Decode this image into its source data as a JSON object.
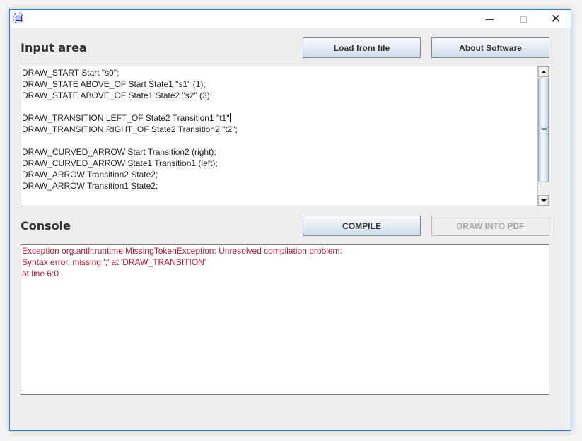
{
  "window": {
    "title": "",
    "icon": "java-app-icon",
    "controls": {
      "minimize": "minimize-icon",
      "maximize": "maximize-icon",
      "close": "close-icon",
      "close_glyph": "✕"
    }
  },
  "input_section": {
    "heading": "Input area",
    "buttons": {
      "load_label": "Load from file",
      "about_label": "About Software"
    },
    "lines": [
      "DRAW_START Start \"s0\";",
      "DRAW_STATE ABOVE_OF Start State1 \"s1\" (1);",
      "DRAW_STATE ABOVE_OF State1 State2 \"s2\" (3);",
      "",
      "DRAW_TRANSITION LEFT_OF State2 Transition1 \"t1\"",
      "DRAW_TRANSITION RIGHT_OF State2 Transition2 \"t2\";",
      "",
      "DRAW_CURVED_ARROW Start Transition2 (right);",
      "DRAW_CURVED_ARROW State1 Transition1 (left);",
      "DRAW_ARROW Transition2 State2;",
      "DRAW_ARROW Transition1 State2;"
    ]
  },
  "console_section": {
    "heading": "Console",
    "buttons": {
      "compile_label": "COMPILE",
      "pdf_label": "DRAW INTO PDF",
      "pdf_enabled": false
    },
    "lines": [
      "Exception org.antlr.runtime.MissingTokenException: Unresolved compilation problem:",
      "Syntax error, missing ';' at 'DRAW_TRANSITION'",
      "at line 6:0"
    ],
    "error_color": "#c0142e"
  },
  "colors": {
    "window_border": "#1883d7",
    "body_bg": "#eeeeee"
  }
}
